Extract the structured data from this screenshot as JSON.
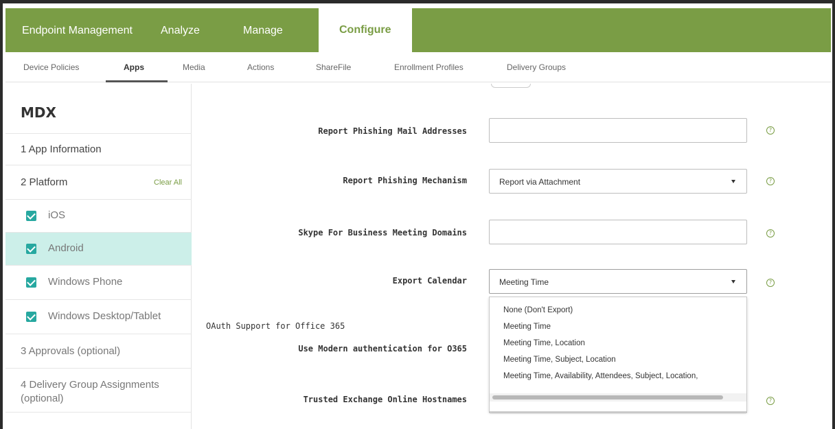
{
  "header": {
    "brand": "Endpoint Management",
    "nav": [
      "Analyze",
      "Manage",
      "Configure"
    ],
    "active_color": "#7a9d45"
  },
  "subnav": {
    "items": [
      "Device Policies",
      "Apps",
      "Media",
      "Actions",
      "ShareFile",
      "Enrollment Profiles",
      "Delivery Groups"
    ],
    "active": "Apps"
  },
  "sidebar": {
    "title": "MDX",
    "app_information": "1  App Information",
    "platform": "2  Platform",
    "clear_all": "Clear All",
    "platforms": [
      {
        "label": "iOS",
        "checked": true
      },
      {
        "label": "Android",
        "checked": true,
        "selected": true
      },
      {
        "label": "Windows Phone",
        "checked": true
      },
      {
        "label": "Windows Desktop/Tablet",
        "checked": true
      }
    ],
    "approvals": "3  Approvals (optional)",
    "delivery_line1": "4  Delivery Group Assignments",
    "delivery_line2": "(optional)"
  },
  "form": {
    "report_phishing_addresses": {
      "label": "Report Phishing Mail Addresses",
      "value": ""
    },
    "report_phishing_mechanism": {
      "label": "Report Phishing Mechanism",
      "value": "Report via Attachment"
    },
    "skype_domains": {
      "label": "Skype For Business Meeting Domains",
      "value": ""
    },
    "export_calendar": {
      "label": "Export Calendar",
      "value": "Meeting Time",
      "options": [
        "None (Don't Export)",
        "Meeting Time",
        "Meeting Time, Location",
        "Meeting Time, Subject, Location",
        "Meeting Time, Availability, Attendees, Subject, Location,"
      ]
    },
    "oauth_section": "OAuth Support for Office 365",
    "modern_auth": {
      "label": "Use Modern authentication for O365"
    },
    "trusted_hostnames": {
      "label": "Trusted Exchange Online Hostnames"
    },
    "help_glyph": "?"
  }
}
